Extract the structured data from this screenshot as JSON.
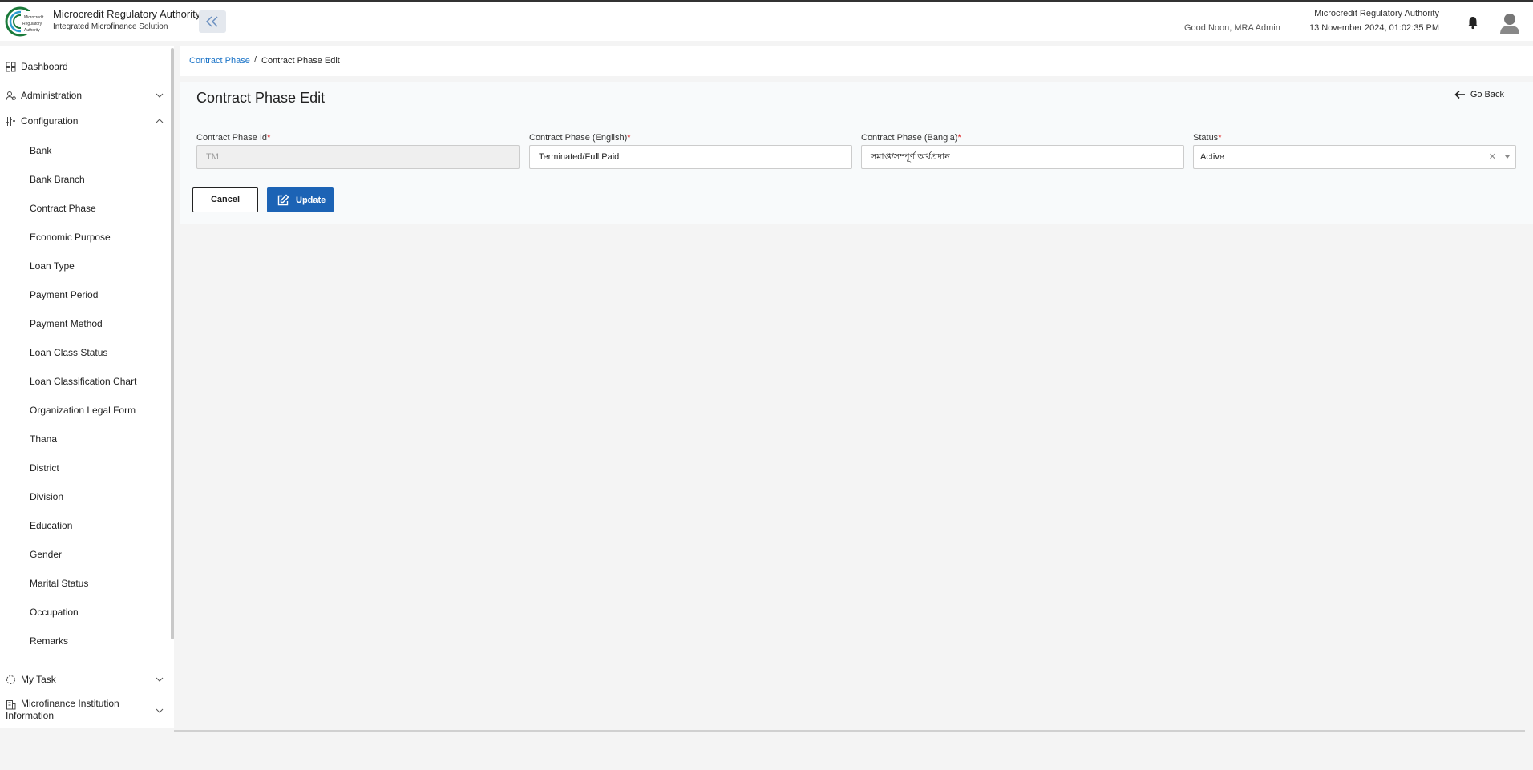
{
  "header": {
    "app_title": "Microcredit Regulatory Authority",
    "app_subtitle": "Integrated Microfinance Solution",
    "logo_text": "Microcredit Regulatory Authority",
    "greeting": "Good Noon, MRA Admin",
    "org_name": "Microcredit Regulatory Authority",
    "datetime": "13 November 2024, 01:02:35 PM"
  },
  "sidebar": {
    "dashboard": "Dashboard",
    "administration": "Administration",
    "configuration": "Configuration",
    "config_items": [
      "Bank",
      "Bank Branch",
      "Contract Phase",
      "Economic Purpose",
      "Loan Type",
      "Payment Period",
      "Payment Method",
      "Loan Class Status",
      "Loan Classification Chart",
      "Organization Legal Form",
      "Thana",
      "District",
      "Division",
      "Education",
      "Gender",
      "Marital Status",
      "Occupation",
      "Remarks"
    ],
    "my_task": "My Task",
    "mfi_info": "Microfinance Institution Information"
  },
  "breadcrumb": {
    "parent": "Contract Phase",
    "separator": "/",
    "current": "Contract Phase Edit"
  },
  "form": {
    "title": "Contract Phase Edit",
    "go_back": "Go Back",
    "fields": {
      "id_label": "Contract Phase Id",
      "id_value": "TM",
      "english_label": "Contract Phase (English)",
      "english_value": "Terminated/Full Paid",
      "bangla_label": "Contract Phase (Bangla)",
      "bangla_value": "সমাপ্ত/সম্পূর্ণ অর্থপ্রদান",
      "status_label": "Status",
      "status_value": "Active",
      "required_mark": "*"
    },
    "cancel_label": "Cancel",
    "update_label": "Update"
  },
  "colors": {
    "primary": "#1c63b5",
    "link": "#1a73c7",
    "required": "#dd2222"
  }
}
